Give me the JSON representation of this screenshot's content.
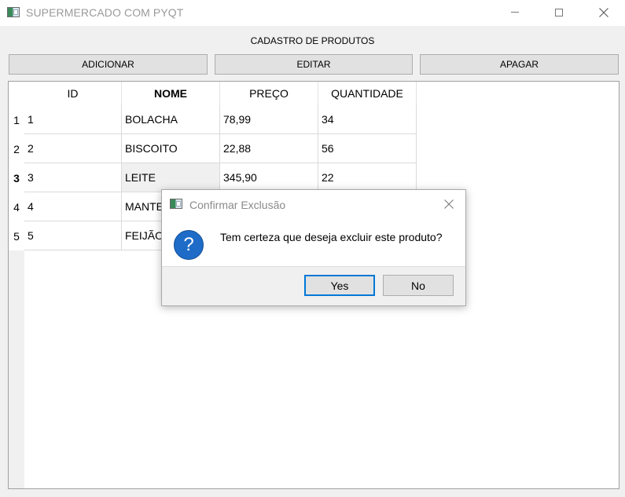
{
  "window": {
    "title": "SUPERMERCADO COM PYQT"
  },
  "header": {
    "label": "CADASTRO DE PRODUTOS"
  },
  "toolbar": {
    "add_label": "ADICIONAR",
    "edit_label": "EDITAR",
    "delete_label": "APAGAR"
  },
  "table": {
    "columns": [
      "ID",
      "NOME",
      "PREÇO",
      "QUANTIDADE"
    ],
    "row_numbers": [
      "1",
      "2",
      "3",
      "4",
      "5"
    ],
    "rows": [
      [
        "1",
        "BOLACHA",
        "78,99",
        "34"
      ],
      [
        "2",
        "BISCOITO",
        "22,88",
        "56"
      ],
      [
        "3",
        "LEITE",
        "345,90",
        "22"
      ],
      [
        "4",
        "MANTEIGA",
        "",
        ""
      ],
      [
        "5",
        "FEIJÃO",
        "",
        ""
      ]
    ]
  },
  "dialog": {
    "title": "Confirmar Exclusão",
    "message": "Tem certeza que deseja excluir este produto?",
    "icon": "question-icon",
    "yes_label": "Yes",
    "no_label": "No"
  },
  "colors": {
    "accent": "#0078d7",
    "question_icon": "#1e6cc8"
  }
}
